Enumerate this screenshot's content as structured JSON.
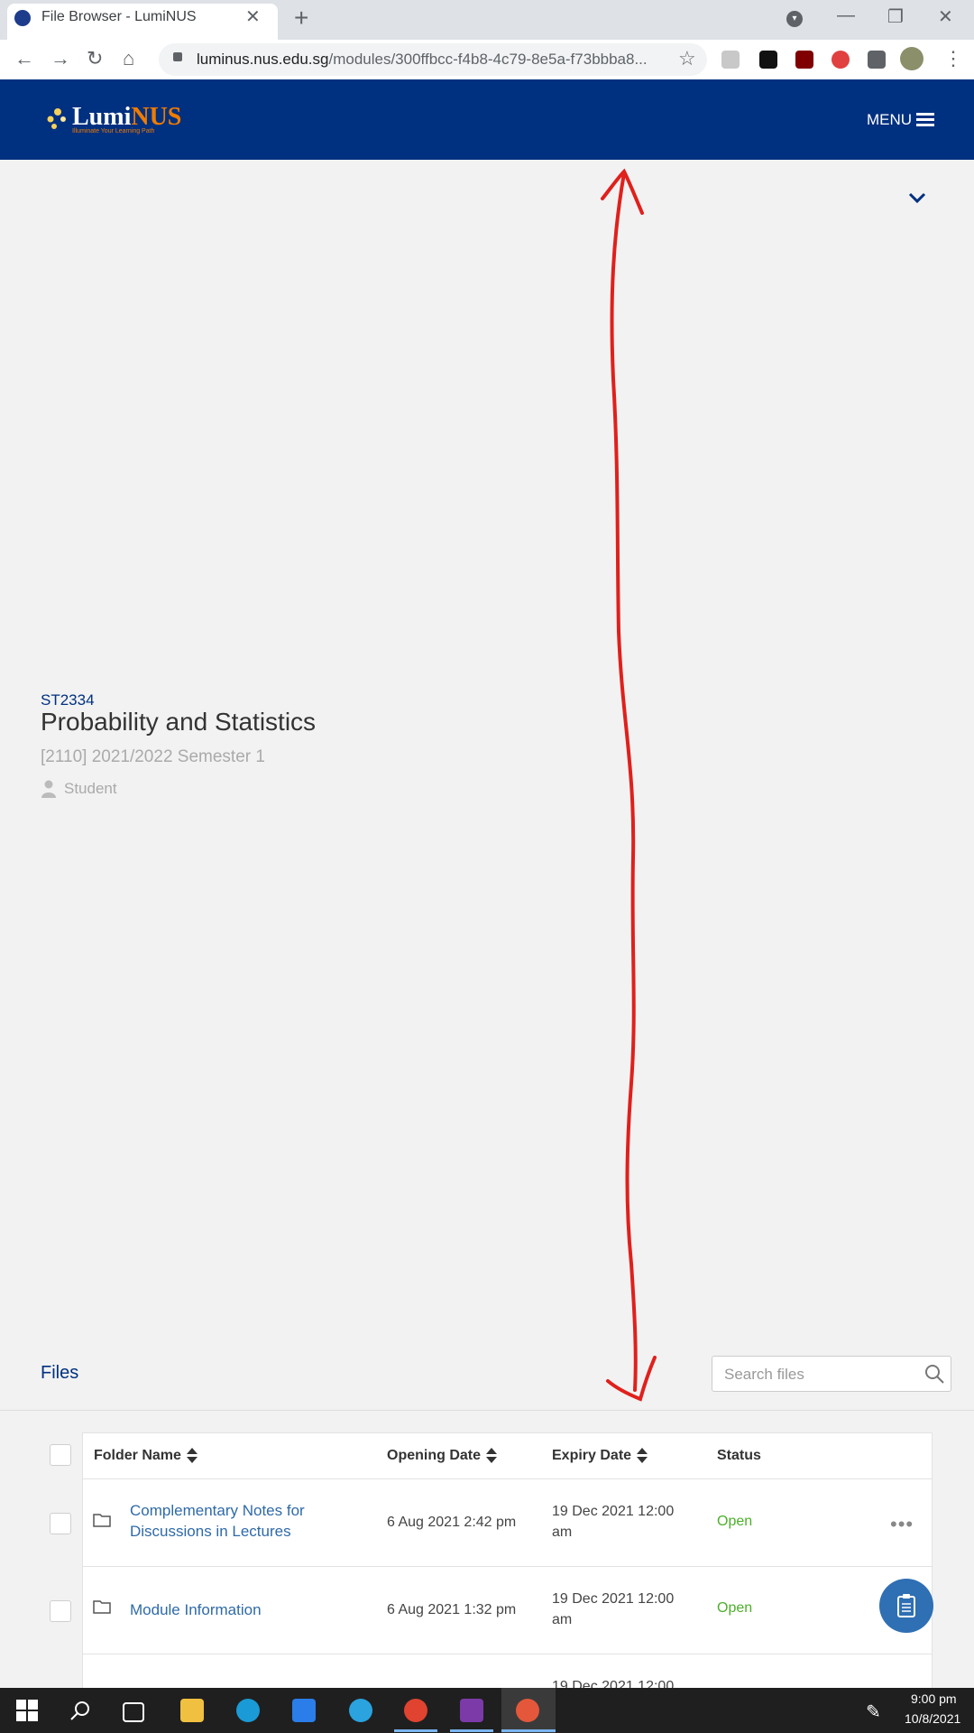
{
  "browser": {
    "tab_title": "File Browser - LumiNUS",
    "url_host": "luminus.nus.edu.sg",
    "url_path": "/modules/300ffbcc-f4b8-4c79-8e5a-f73bbba8..."
  },
  "header": {
    "logo_main": "Lumi",
    "logo_accent": "NUS",
    "logo_tagline": "Illuminate Your Learning Path",
    "menu_label": "MENU"
  },
  "module": {
    "code": "ST2334",
    "name": "Probability and Statistics",
    "semester": "[2110] 2021/2022 Semester 1",
    "role": "Student"
  },
  "files": {
    "section_label": "Files",
    "search_placeholder": "Search files",
    "columns": [
      "Folder Name",
      "Opening Date",
      "Expiry Date",
      "Status"
    ],
    "rows": [
      {
        "name_line1": "Complementary Notes for",
        "name_line2": "Discussions in Lectures",
        "opening": "6 Aug 2021 2:42 pm",
        "expiry_line1": "19 Dec 2021 12:00",
        "expiry_line2": "am",
        "status": "Open"
      },
      {
        "name_line1": "Module Information",
        "name_line2": "",
        "opening": "6 Aug 2021 1:32 pm",
        "expiry_line1": "19 Dec 2021 12:00",
        "expiry_line2": "am",
        "status": "Open"
      },
      {
        "expiry_line1": "19 Dec 2021 12:00"
      }
    ]
  },
  "taskbar": {
    "time": "9:00 pm",
    "date": "10/8/2021"
  },
  "colors": {
    "brand_blue": "#003080",
    "brand_orange": "#ef7c00",
    "status_open": "#4caf2a",
    "annotation_red": "#e0201c"
  }
}
